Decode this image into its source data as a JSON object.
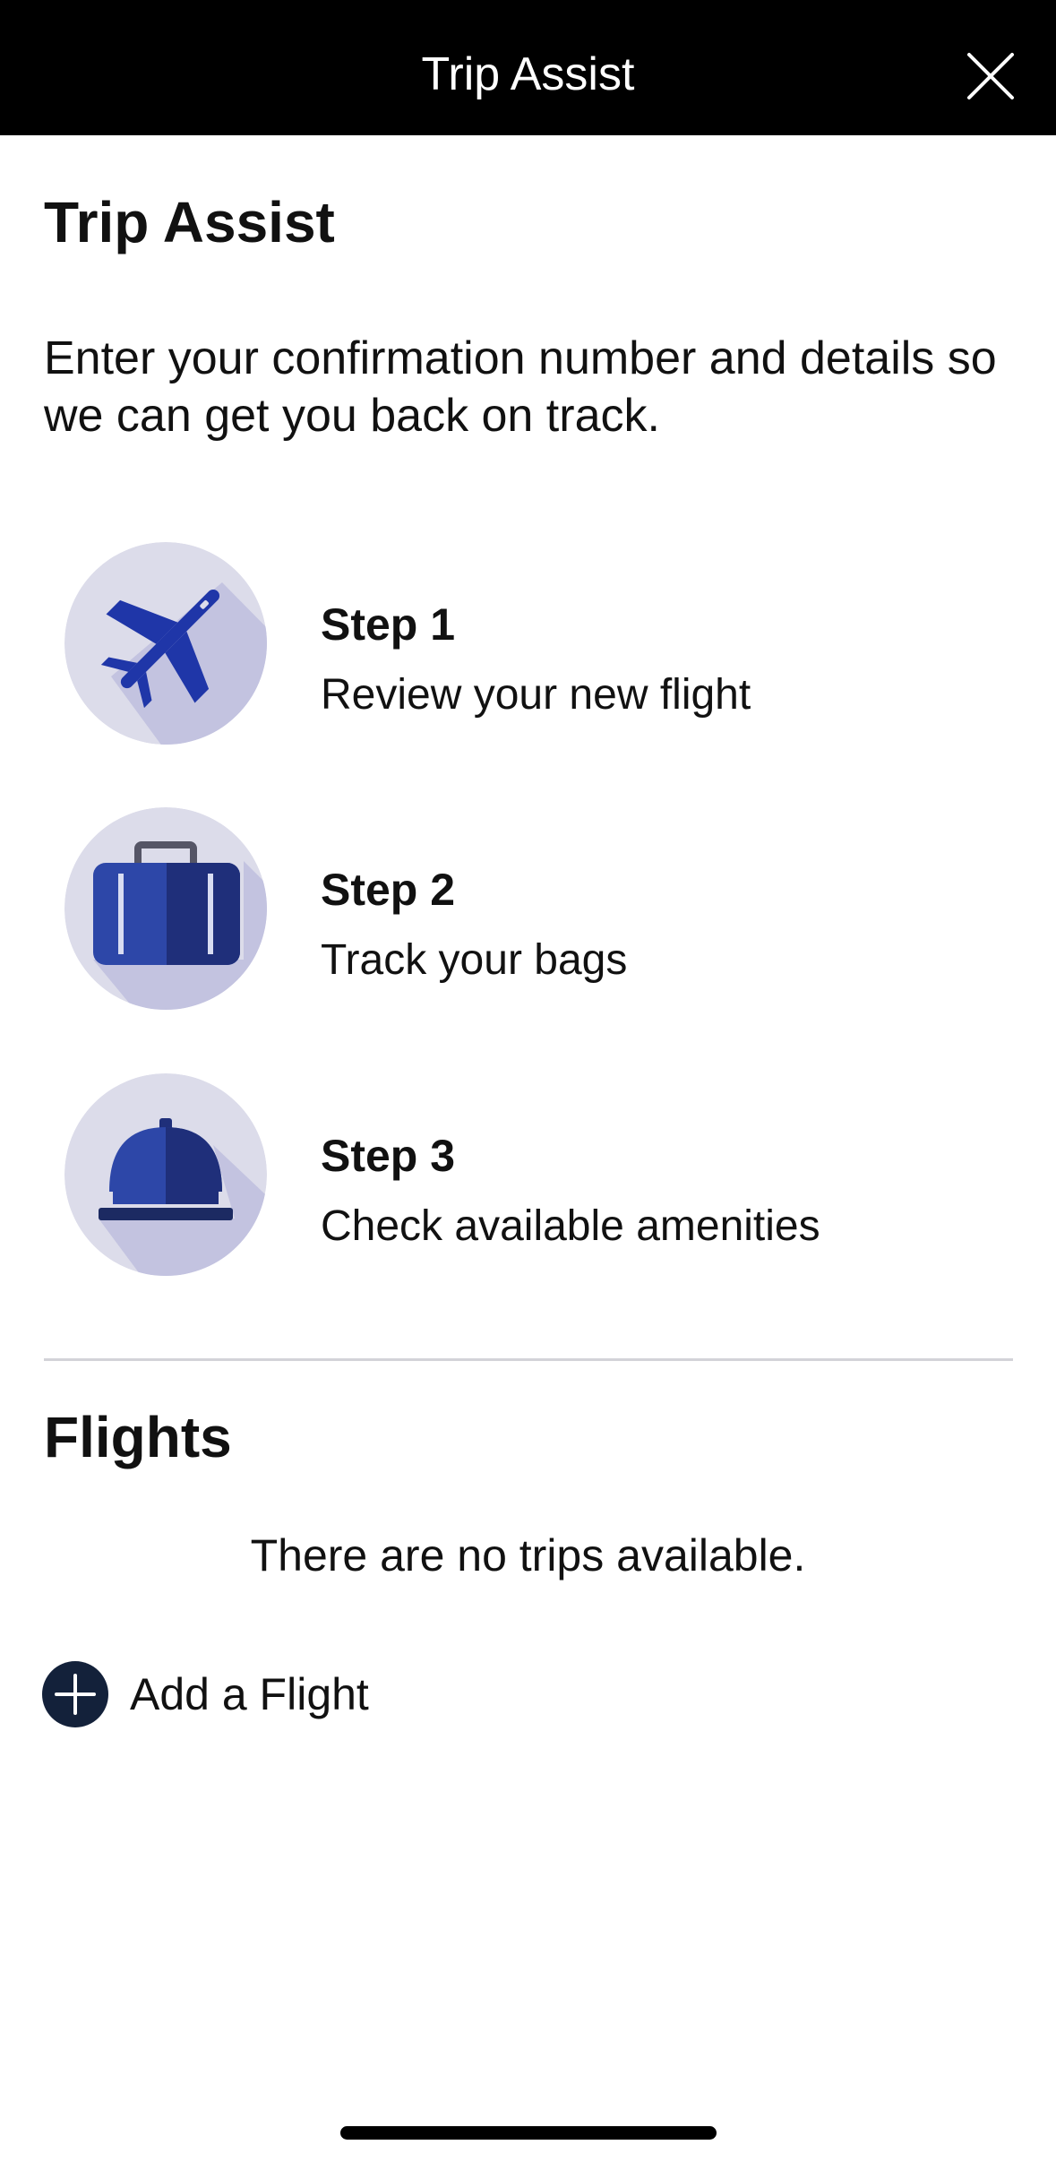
{
  "header": {
    "title": "Trip Assist",
    "close_icon": "close-icon"
  },
  "intro": {
    "title": "Trip Assist",
    "description": "Enter your confirmation number and details so we can get you back on track."
  },
  "steps": [
    {
      "title": "Step 1",
      "description": "Review your new flight",
      "icon": "airplane-icon"
    },
    {
      "title": "Step 2",
      "description": "Track your bags",
      "icon": "suitcase-icon"
    },
    {
      "title": "Step 3",
      "description": "Check available amenities",
      "icon": "service-bell-icon"
    }
  ],
  "flights": {
    "title": "Flights",
    "empty_message": "There are no trips available.",
    "add_label": "Add a Flight",
    "add_icon": "plus-circle-icon"
  },
  "colors": {
    "header_bg": "#000000",
    "icon_circle": "#dcdcea",
    "icon_shadow": "#c0c0df",
    "icon_primary": "#1f36a8",
    "add_button": "#13213a"
  }
}
